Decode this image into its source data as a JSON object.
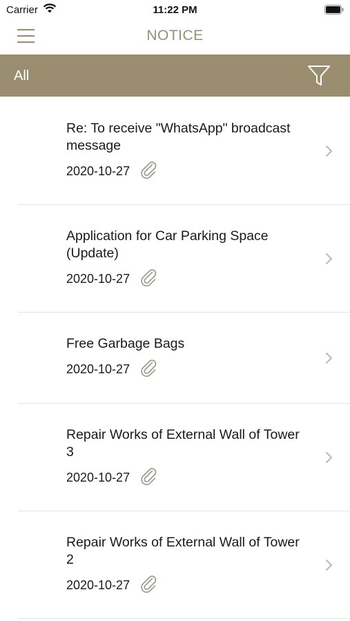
{
  "status_bar": {
    "carrier": "Carrier",
    "time": "11:22 PM"
  },
  "nav": {
    "title": "NOTICE",
    "menu_icon": "hamburger-menu-icon"
  },
  "filter": {
    "label": "All",
    "icon": "funnel-filter-icon"
  },
  "colors": {
    "accent": "#9b8e70",
    "title": "#9b8f74",
    "chevron": "#b8b8b8"
  },
  "notices": [
    {
      "title": "Re: To receive \"WhatsApp\" broadcast message",
      "date": "2020-10-27",
      "has_attachment": true
    },
    {
      "title": "Application for Car Parking Space (Update)",
      "date": "2020-10-27",
      "has_attachment": true
    },
    {
      "title": "Free Garbage Bags",
      "date": "2020-10-27",
      "has_attachment": true
    },
    {
      "title": "Repair Works of External Wall of Tower 3",
      "date": "2020-10-27",
      "has_attachment": true
    },
    {
      "title": "Repair Works of External Wall of Tower 2",
      "date": "2020-10-27",
      "has_attachment": true
    }
  ]
}
